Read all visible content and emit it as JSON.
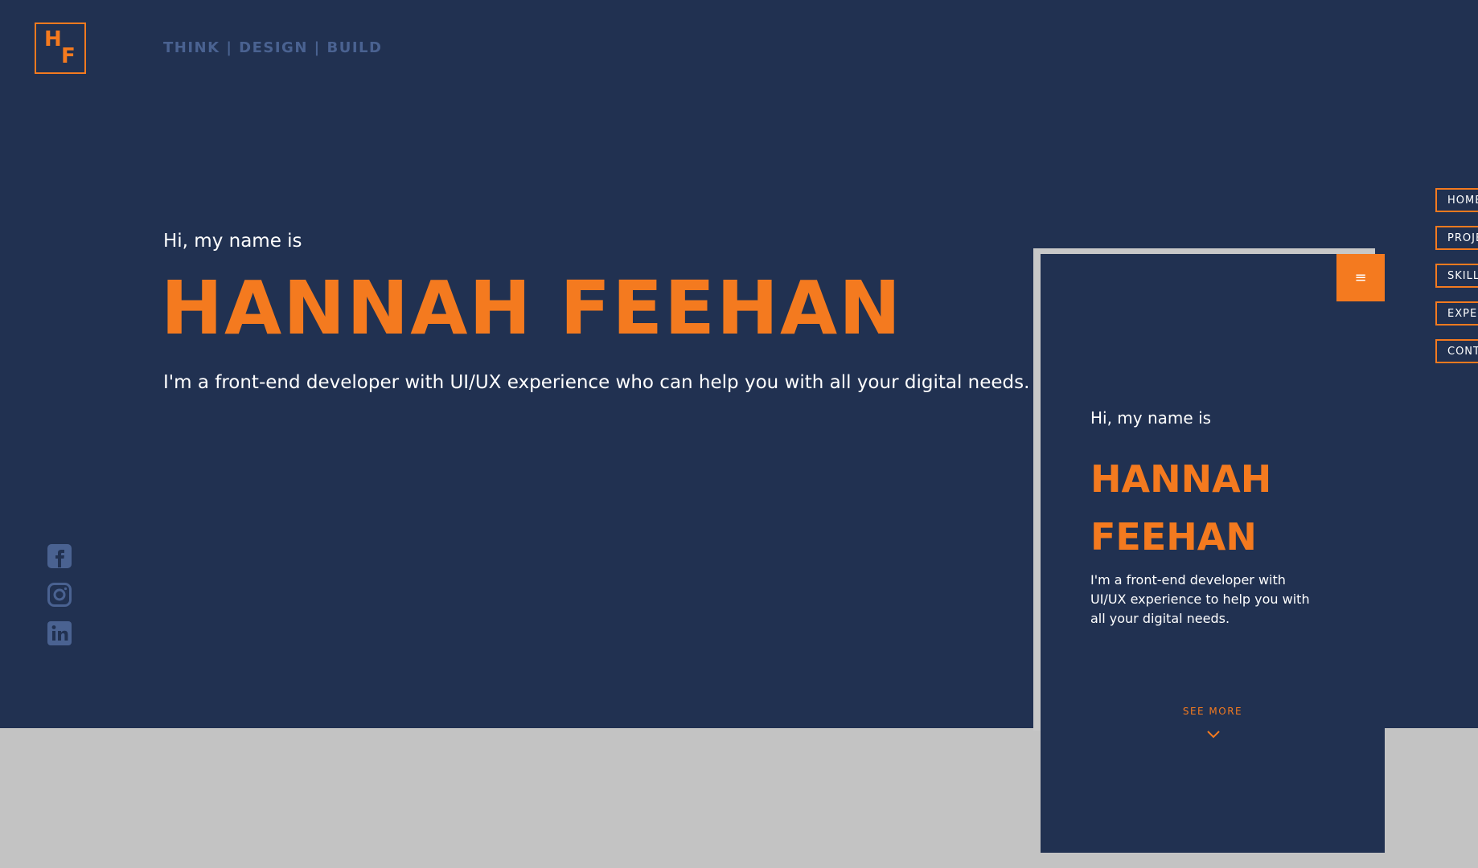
{
  "brand": {
    "logo_letter_1": "H",
    "logo_letter_2": "F",
    "tagline": "THINK | DESIGN | BUILD"
  },
  "hero": {
    "greeting": "Hi, my name is",
    "name": "HANNAH FEEHAN",
    "intro": "I'm a front-end developer with UI/UX experience who can help you with all your digital needs."
  },
  "social": [
    {
      "icon": "facebook-icon"
    },
    {
      "icon": "instagram-icon"
    },
    {
      "icon": "linkedin-icon"
    }
  ],
  "nav": {
    "items": [
      {
        "label": "HOME"
      },
      {
        "label": "PROJECTS"
      },
      {
        "label": "SKILLS"
      },
      {
        "label": "EXPERIENCE"
      },
      {
        "label": "CONTACT"
      }
    ]
  },
  "mobile": {
    "menu_icon": "≡",
    "greeting": "Hi, my name is",
    "name": "HANNAH FEEHAN",
    "intro": "I'm a front-end developer with UI/UX experience to help you with all your digital needs.",
    "see_more": "SEE MORE"
  },
  "colors": {
    "navy": "#213151",
    "orange": "#f47a1f",
    "muted_blue": "#4a6291",
    "gray": "#c3c3c3"
  }
}
